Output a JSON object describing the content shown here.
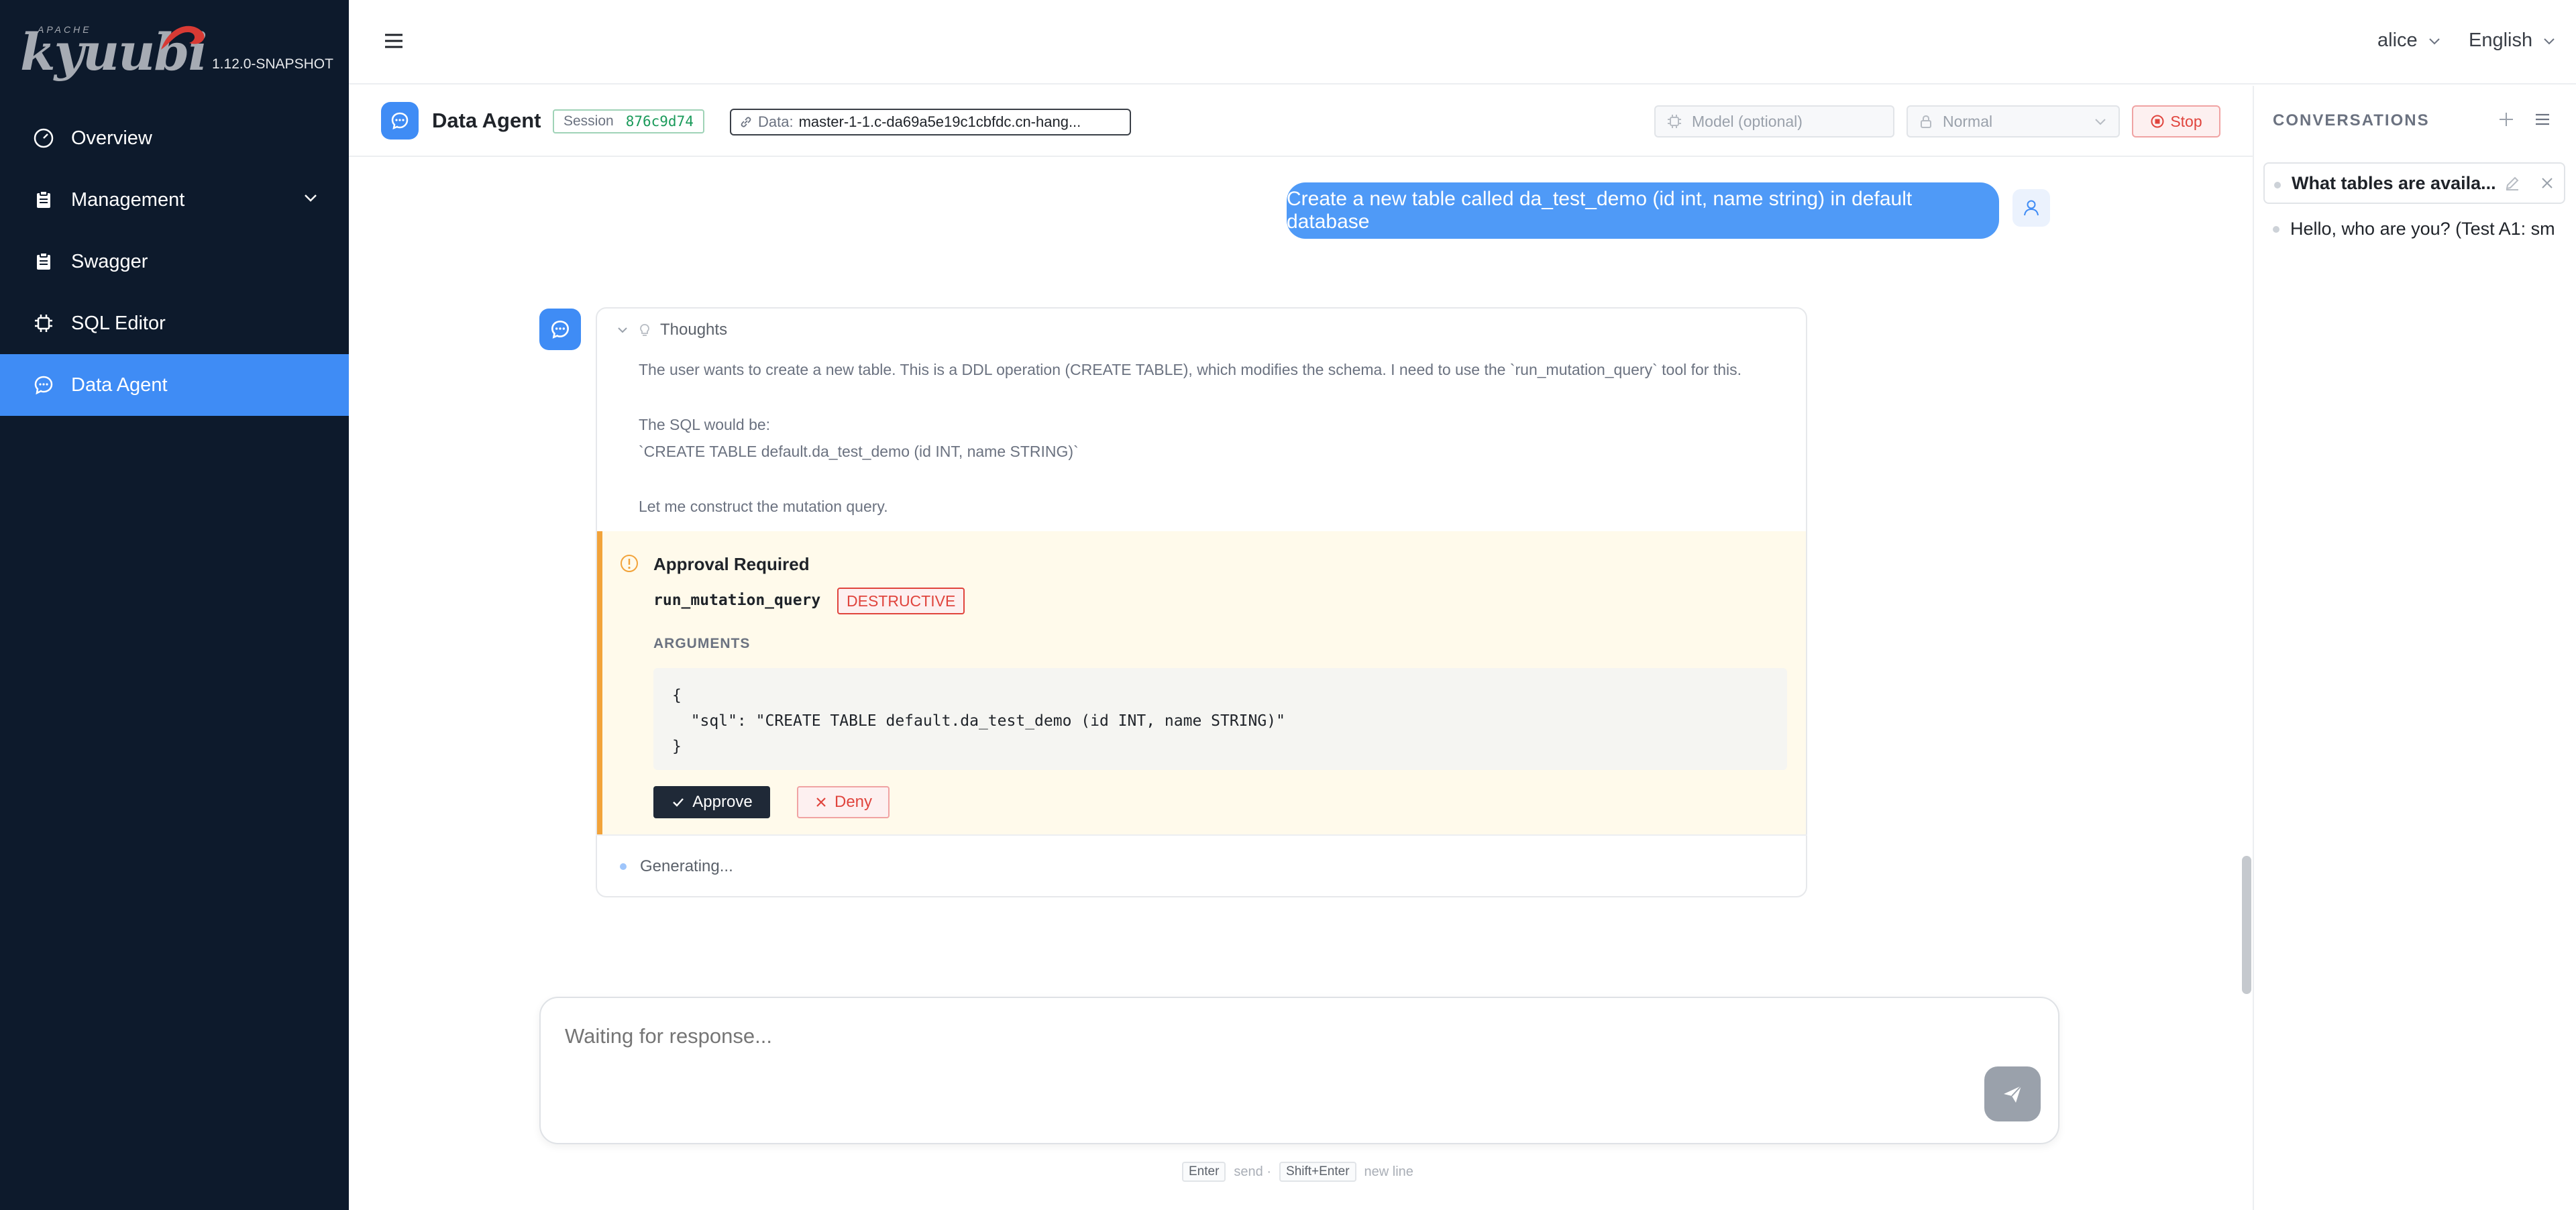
{
  "brand": {
    "wordmark": "kyuubi",
    "apache": "APACHE",
    "version": "1.12.0-SNAPSHOT",
    "accent": "#3f8cf5",
    "logo_red": "#d83a34"
  },
  "sidebar": {
    "items": [
      {
        "label": "Overview",
        "icon": "dashboard-icon"
      },
      {
        "label": "Management",
        "icon": "clipboard-icon"
      },
      {
        "label": "Swagger",
        "icon": "clipboard-icon"
      },
      {
        "label": "SQL Editor",
        "icon": "chip-icon"
      },
      {
        "label": "Data Agent",
        "icon": "chat-icon",
        "active": true
      }
    ]
  },
  "header": {
    "user": "alice",
    "language": "English"
  },
  "agent_bar": {
    "title": "Data Agent",
    "session_label": "Session",
    "session_id": "876c9d74",
    "data_label": "Data:",
    "data_value": "master-1-1.c-da69a5e19c1cbfdc.cn-hang...",
    "model_placeholder": "Model (optional)",
    "mode": "Normal",
    "stop_label": "Stop"
  },
  "conversations": {
    "title": "CONVERSATIONS",
    "items": [
      {
        "label": "What tables are availa...",
        "active": true
      },
      {
        "label": "Hello, who are you? (Test A1: sm",
        "active": false
      }
    ]
  },
  "chat": {
    "user_message": "Create a new table called da_test_demo (id int, name string) in default database",
    "thoughts_label": "Thoughts",
    "thoughts": [
      "The user wants to create a new table. This is a DDL operation (CREATE TABLE), which modifies the schema. I need to use the `run_mutation_query` tool for this.",
      "The SQL would be:",
      "`CREATE TABLE default.da_test_demo (id INT, name STRING)`",
      "Let me construct the mutation query."
    ],
    "approval": {
      "title": "Approval Required",
      "tool": "run_mutation_query",
      "tag": "DESTRUCTIVE",
      "arguments_label": "ARGUMENTS",
      "code": "{\n  \"sql\": \"CREATE TABLE default.da_test_demo (id INT, name STRING)\"\n}",
      "approve_label": "Approve",
      "deny_label": "Deny"
    },
    "status": "Generating..."
  },
  "composer": {
    "placeholder": "Waiting for response...",
    "hint_enter_key": "Enter",
    "hint_enter_text": "send ·",
    "hint_shift_key": "Shift+Enter",
    "hint_shift_text": "new line"
  }
}
